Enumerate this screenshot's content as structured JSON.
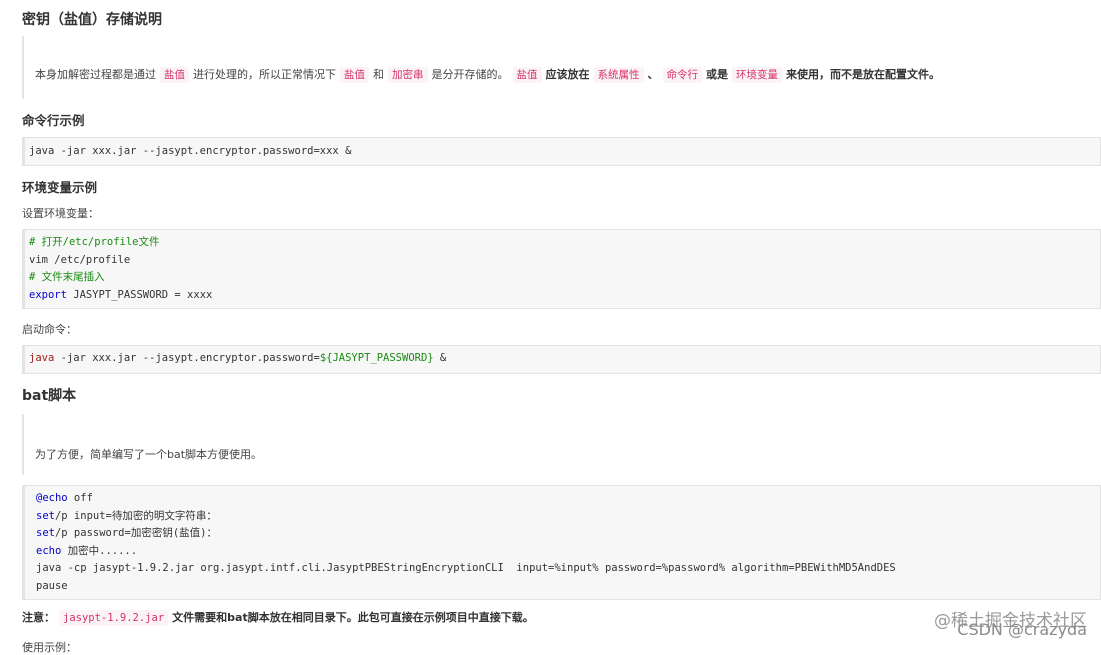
{
  "title": "密钥（盐值）存储说明",
  "intro": {
    "t1": "本身加解密过程都是通过",
    "tag_salt": "盐值",
    "t2": "进行处理的，所以正常情况下",
    "tag_salt2": "盐值",
    "t3": "和",
    "tag_encrypted": "加密串",
    "t4": "是分开存储的。",
    "tag_salt3": "盐值",
    "t5": "应该放在",
    "tag_sysprop": "系统属性",
    "t6": "、",
    "tag_cmd": "命令行",
    "t7": "或是",
    "tag_env": "环境变量",
    "t8": "来使用，而不是放在配置文件。"
  },
  "cmd_section": {
    "heading": "命令行示例",
    "code": "java -jar xxx.jar --jasypt.encryptor.password=xxx &"
  },
  "env_section": {
    "heading": "环境变量示例",
    "set_label": "设置环境变量：",
    "code_lines": {
      "l1": "# 打开/etc/profile文件",
      "l2": "vim /etc/profile",
      "l3": "# 文件末尾插入",
      "l4_kw": "export",
      "l4_rest": " JASYPT_PASSWORD = xxxx"
    },
    "start_label": "启动命令：",
    "start_code": {
      "kw": "java",
      "mid": " -jar xxx.jar --jasypt.encryptor.password=",
      "var": "${JASYPT_PASSWORD}",
      "end": " &"
    }
  },
  "bat_section": {
    "heading": "bat脚本",
    "desc": "为了方便，简单编写了一个bat脚本方便使用。",
    "lines": {
      "l1_kw": "@echo",
      "l1_rest": " off",
      "l2_kw": "set",
      "l2_rest": "/p input=待加密的明文字符串：",
      "l3_kw": "set",
      "l3_rest": "/p password=加密密钥(盐值)：",
      "l4_kw": "echo",
      "l4_rest": " 加密中......",
      "l5": "java -cp jasypt-1.9.2.jar org.jasypt.intf.cli.JasyptPBEStringEncryptionCLI  input=%input% password=%password% algorithm=PBEWithMD5AndDES",
      "l6": "pause"
    }
  },
  "note": {
    "label": "注意：",
    "tag_jar": "jasypt-1.9.2.jar",
    "text": "文件需要和bat脚本放在相同目录下。此包可直接在示例项目中直接下载。"
  },
  "usage_label": "使用示例：",
  "watermark": {
    "line1": "@稀土掘金技术社区",
    "line2": "CSDN @crazyda"
  }
}
